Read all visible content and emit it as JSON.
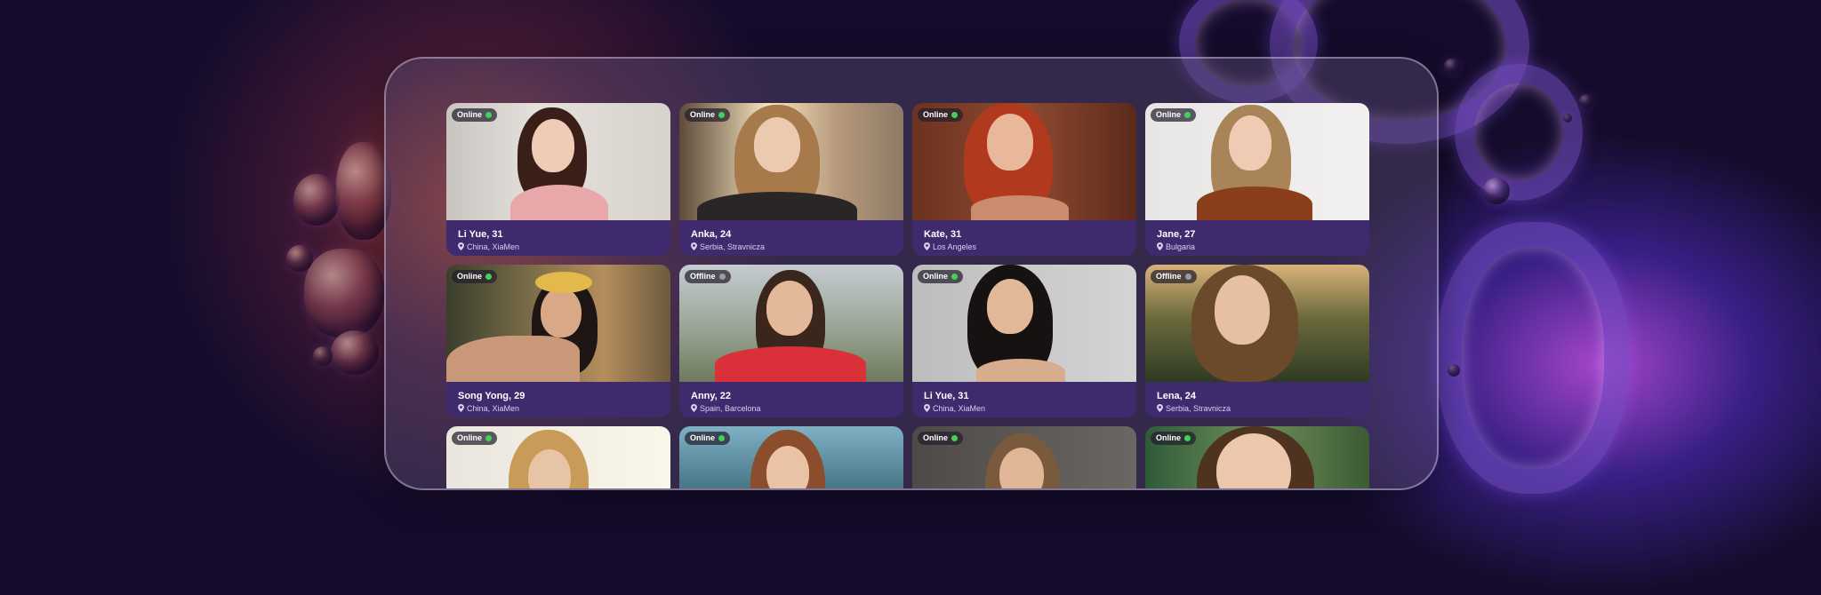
{
  "profiles": [
    {
      "name": "Li Yue, 31",
      "location": "China, XiaMen",
      "status": "Online"
    },
    {
      "name": "Anka, 24",
      "location": "Serbia, Stravnicza",
      "status": "Online"
    },
    {
      "name": "Kate, 31",
      "location": "Los Angeles",
      "status": "Online"
    },
    {
      "name": "Jane, 27",
      "location": "Bulgaria",
      "status": "Online"
    },
    {
      "name": "Song Yong, 29",
      "location": "China, XiaMen",
      "status": "Online"
    },
    {
      "name": "Anny, 22",
      "location": "Spain, Barcelona",
      "status": "Offline"
    },
    {
      "name": "Li Yue, 31",
      "location": "China, XiaMen",
      "status": "Online"
    },
    {
      "name": "Lena, 24",
      "location": "Serbia, Stravnicza",
      "status": "Offline"
    },
    {
      "name": "",
      "location": "",
      "status": "Online"
    },
    {
      "name": "",
      "location": "",
      "status": "Online"
    },
    {
      "name": "",
      "location": "",
      "status": "Online"
    },
    {
      "name": "",
      "location": "",
      "status": "Online"
    }
  ],
  "colors": {
    "online": "#43d05a",
    "offline": "#9a9aa2",
    "card_info": "#3f2a6e"
  },
  "icons": {
    "location": "location-pin-icon",
    "status": "status-dot-icon"
  }
}
